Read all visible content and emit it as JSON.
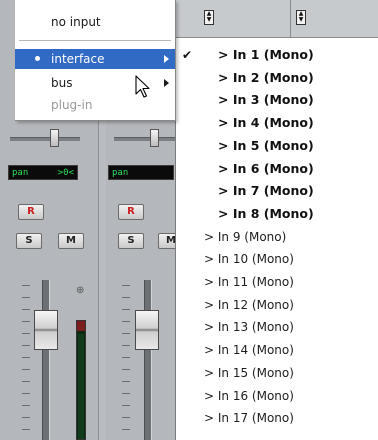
{
  "popup_menu": {
    "items": [
      {
        "label": "no input",
        "enabled": true,
        "submenu": false
      },
      {
        "label": "interface",
        "enabled": true,
        "selected": true,
        "highlighted": true,
        "submenu": true
      },
      {
        "label": "bus",
        "enabled": true,
        "submenu": true
      },
      {
        "label": "plug-in",
        "enabled": false,
        "submenu": false
      }
    ],
    "highlight_color": "#316ac5"
  },
  "submenu": {
    "items": [
      {
        "label": "> In 1 (Mono)",
        "bold": true,
        "checked": true
      },
      {
        "label": "> In 2 (Mono)",
        "bold": true,
        "checked": false
      },
      {
        "label": "> In 3 (Mono)",
        "bold": true,
        "checked": false
      },
      {
        "label": "> In 4 (Mono)",
        "bold": true,
        "checked": false
      },
      {
        "label": "> In 5 (Mono)",
        "bold": true,
        "checked": false
      },
      {
        "label": "> In 6 (Mono)",
        "bold": true,
        "checked": false
      },
      {
        "label": "> In 7 (Mono)",
        "bold": true,
        "checked": false
      },
      {
        "label": "> In 8 (Mono)",
        "bold": true,
        "checked": false
      },
      {
        "label": "> In 9 (Mono)",
        "bold": false,
        "checked": false
      },
      {
        "label": "> In 10 (Mono)",
        "bold": false,
        "checked": false
      },
      {
        "label": "> In 11 (Mono)",
        "bold": false,
        "checked": false
      },
      {
        "label": "> In 12 (Mono)",
        "bold": false,
        "checked": false
      },
      {
        "label": "> In 13 (Mono)",
        "bold": false,
        "checked": false
      },
      {
        "label": "> In 14 (Mono)",
        "bold": false,
        "checked": false
      },
      {
        "label": "> In 15 (Mono)",
        "bold": false,
        "checked": false
      },
      {
        "label": "> In 16 (Mono)",
        "bold": false,
        "checked": false
      },
      {
        "label": "> In 17 (Mono)",
        "bold": false,
        "checked": false
      }
    ],
    "check_glyph": "✔"
  },
  "mixer": {
    "strips": [
      {
        "pan_label": "pan",
        "pan_value": ">0<",
        "record_label": "R",
        "solo_label": "S",
        "mute_label": "M"
      },
      {
        "pan_label": "pan",
        "pan_value": "",
        "record_label": "R",
        "solo_label": "S",
        "mute_label": "M"
      }
    ],
    "display_text_color": "#2fe05a",
    "record_color": "#c81e1e"
  },
  "icons": {
    "sort": "sort-arrows-icon",
    "submenu_arrow": "chevron-right-icon",
    "cursor": "mouse-pointer-icon",
    "link": "link-icon"
  }
}
